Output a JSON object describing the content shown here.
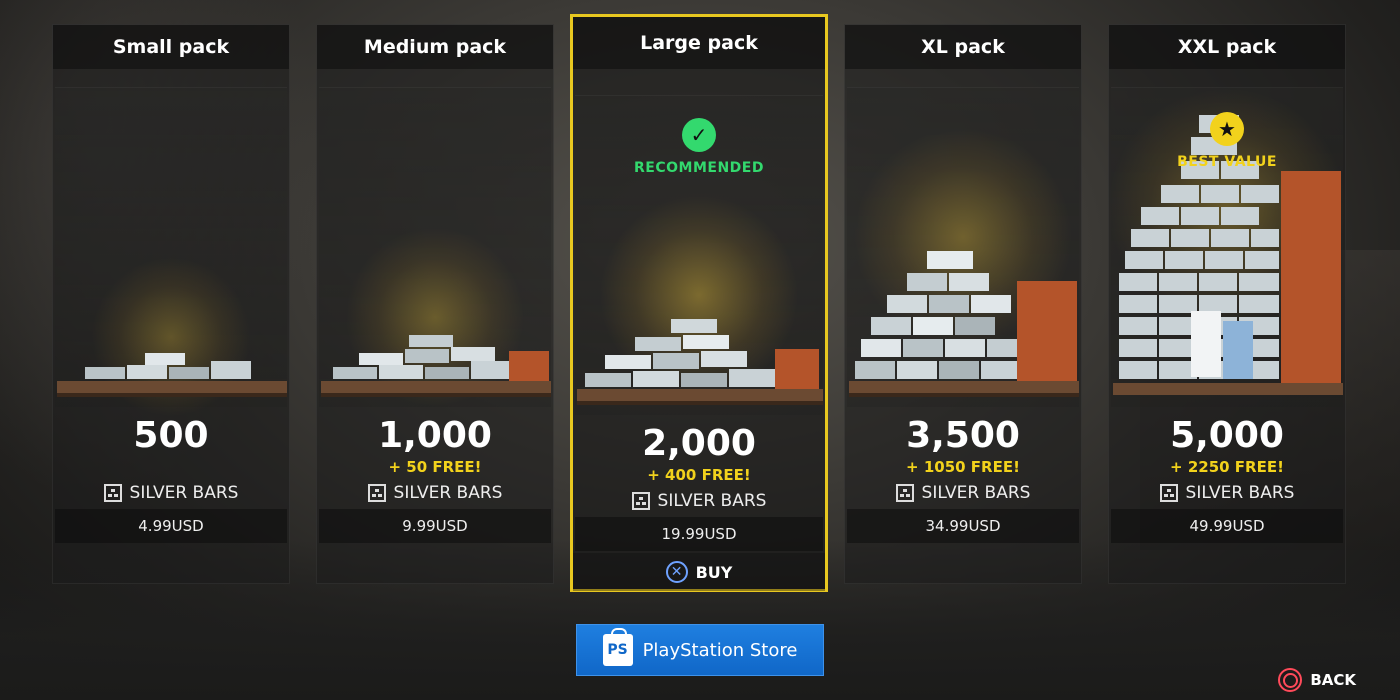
{
  "packs": [
    {
      "title": "Small pack",
      "amount": "500",
      "bonus": "",
      "currency": "SILVER BARS",
      "price": "4.99USD",
      "badge": "",
      "selected": false,
      "pile_level": 0.15
    },
    {
      "title": "Medium pack",
      "amount": "1,000",
      "bonus": "+ 50 FREE!",
      "currency": "SILVER BARS",
      "price": "9.99USD",
      "badge": "",
      "selected": false,
      "pile_level": 0.3
    },
    {
      "title": "Large pack",
      "amount": "2,000",
      "bonus": "+ 400 FREE!",
      "currency": "SILVER BARS",
      "price": "19.99USD",
      "badge": "RECOMMENDED",
      "badge_icon": "check-icon",
      "badge_color": "#33d96e",
      "selected": true,
      "pile_level": 0.45,
      "buy_label": "BUY"
    },
    {
      "title": "XL pack",
      "amount": "3,500",
      "bonus": "+ 1050 FREE!",
      "currency": "SILVER BARS",
      "price": "34.99USD",
      "badge": "",
      "selected": false,
      "pile_level": 0.7
    },
    {
      "title": "XXL pack",
      "amount": "5,000",
      "bonus": "+ 2250 FREE!",
      "currency": "SILVER BARS",
      "price": "49.99USD",
      "badge": "BEST VALUE",
      "badge_icon": "star-icon",
      "badge_color": "#f2d21c",
      "selected": false,
      "pile_level": 1.0
    }
  ],
  "store": {
    "label": "PlayStation Store"
  },
  "footer": {
    "back_label": "BACK"
  },
  "colors": {
    "highlight": "#e8c820",
    "bonus": "#f2d21c",
    "recommended": "#33d96e",
    "cross": "#6fa2ff",
    "circle": "#ff4a5a",
    "store_blue": "#1067c8"
  }
}
